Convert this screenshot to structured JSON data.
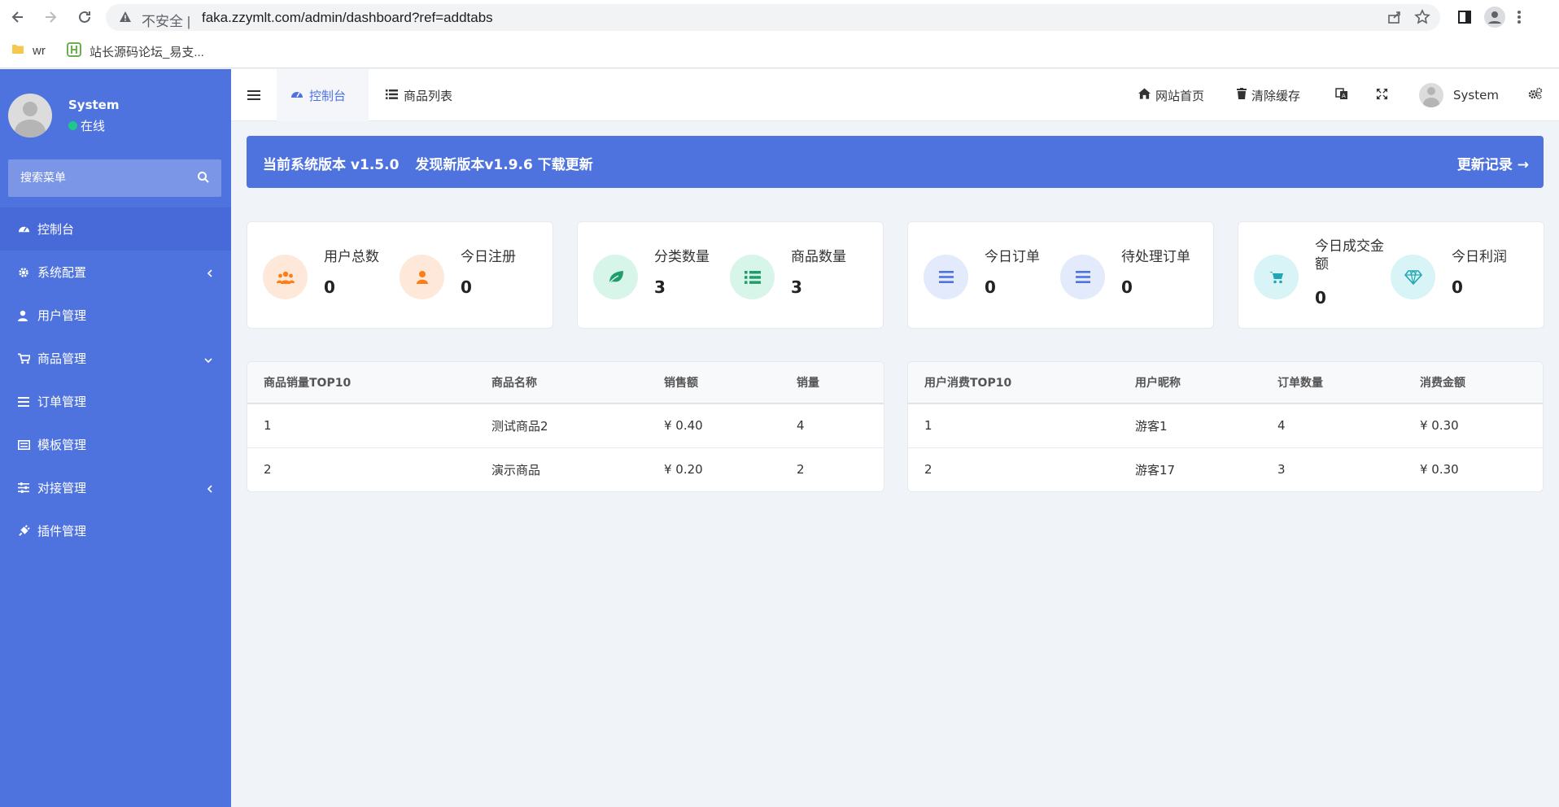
{
  "browser": {
    "insecure_label": "不安全 |",
    "url": "faka.zzymlt.com/admin/dashboard?ref=addtabs",
    "bookmarks": [
      {
        "label": "wr"
      },
      {
        "label": "站长源码论坛_易支..."
      }
    ]
  },
  "sidebar": {
    "user": {
      "name": "System",
      "status": "在线"
    },
    "search_placeholder": "搜索菜单",
    "items": [
      {
        "label": "控制台",
        "icon": "dashboard-icon",
        "active": true
      },
      {
        "label": "系统配置",
        "icon": "gear-icon",
        "arrow": "left"
      },
      {
        "label": "用户管理",
        "icon": "user-icon"
      },
      {
        "label": "商品管理",
        "icon": "cart-icon",
        "arrow": "down"
      },
      {
        "label": "订单管理",
        "icon": "list-icon"
      },
      {
        "label": "模板管理",
        "icon": "template-icon"
      },
      {
        "label": "对接管理",
        "icon": "sliders-icon",
        "arrow": "left"
      },
      {
        "label": "插件管理",
        "icon": "plug-icon"
      }
    ]
  },
  "topbar": {
    "tabs": [
      {
        "label": "控制台",
        "active": true
      },
      {
        "label": "商品列表"
      }
    ],
    "home_label": "网站首页",
    "clear_cache_label": "清除缓存",
    "user_name": "System"
  },
  "banner": {
    "current_version": "当前系统版本 v1.5.0",
    "new_version": "发现新版本v1.9.6 下载更新",
    "changelog": "更新记录 →"
  },
  "stats": [
    {
      "label": "用户总数",
      "value": "0",
      "icon": "users-icon",
      "color": "#fd7e14",
      "bg": "#fde8da"
    },
    {
      "label": "今日注册",
      "value": "0",
      "icon": "user-icon",
      "color": "#fd7e14",
      "bg": "#fde8da"
    },
    {
      "label": "分类数量",
      "value": "3",
      "icon": "leaf-icon",
      "color": "#1f9d6b",
      "bg": "#d8f5ea"
    },
    {
      "label": "商品数量",
      "value": "3",
      "icon": "list-icon",
      "color": "#1f9d6b",
      "bg": "#d8f5ea"
    },
    {
      "label": "今日订单",
      "value": "0",
      "icon": "menu-icon",
      "color": "#4e73df",
      "bg": "#e2eafb"
    },
    {
      "label": "待处理订单",
      "value": "0",
      "icon": "menu-icon",
      "color": "#4e73df",
      "bg": "#e2eafb"
    },
    {
      "label": "今日成交金额",
      "value": "0",
      "icon": "cart-icon",
      "color": "#20a7b3",
      "bg": "#d8f4f6"
    },
    {
      "label": "今日利润",
      "value": "0",
      "icon": "diamond-icon",
      "color": "#20a7b3",
      "bg": "#d8f4f6"
    }
  ],
  "product_table": {
    "headers": [
      "商品销量TOP10",
      "商品名称",
      "销售额",
      "销量"
    ],
    "rows": [
      [
        "1",
        "测试商品2",
        "¥ 0.40",
        "4"
      ],
      [
        "2",
        "演示商品",
        "¥ 0.20",
        "2"
      ]
    ]
  },
  "user_table": {
    "headers": [
      "用户消费TOP10",
      "用户昵称",
      "订单数量",
      "消费金额"
    ],
    "rows": [
      [
        "1",
        "游客1",
        "4",
        "¥ 0.30"
      ],
      [
        "2",
        "游客17",
        "3",
        "¥ 0.30"
      ]
    ]
  }
}
